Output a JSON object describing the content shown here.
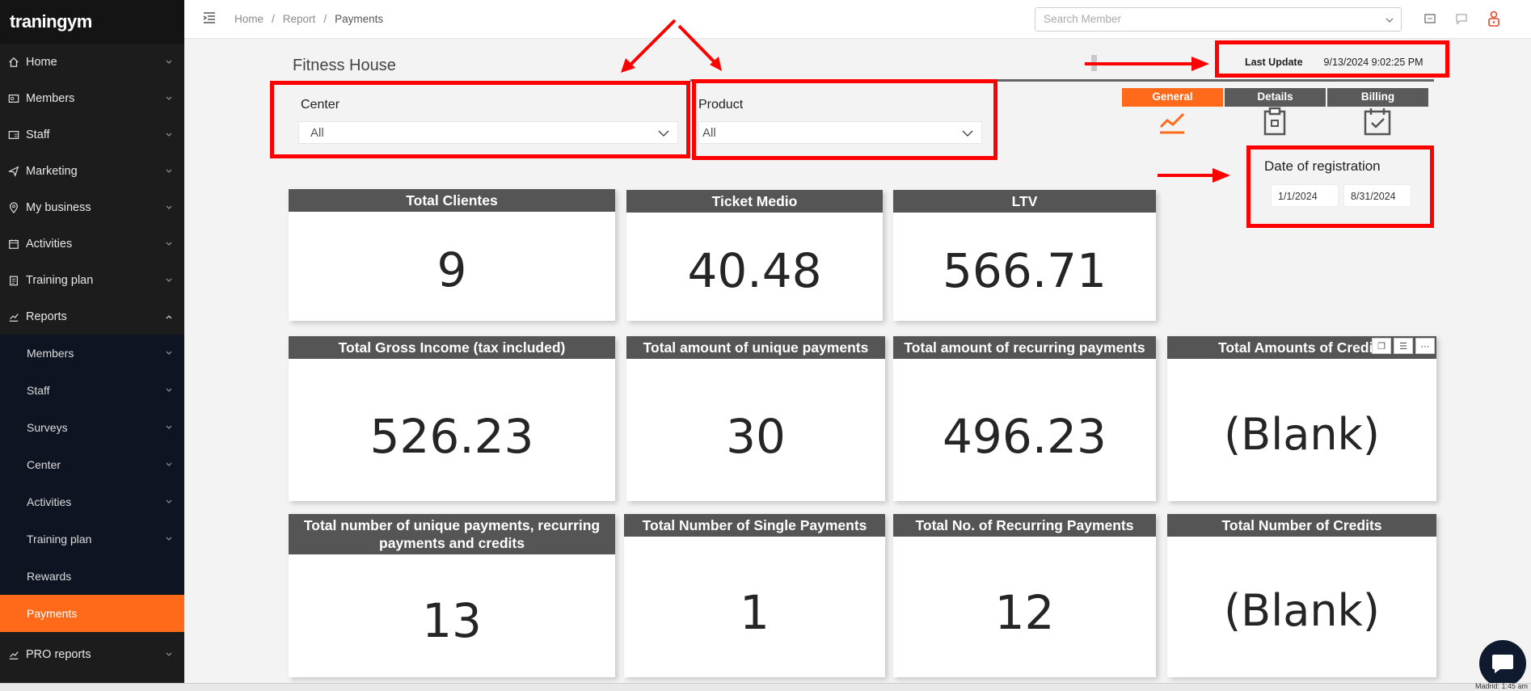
{
  "brand": "traningym",
  "sidebar": {
    "items": [
      {
        "label": "Home",
        "icon": "home-icon"
      },
      {
        "label": "Members",
        "icon": "id-card-icon"
      },
      {
        "label": "Staff",
        "icon": "id-badge-icon"
      },
      {
        "label": "Marketing",
        "icon": "send-icon"
      },
      {
        "label": "My business",
        "icon": "location-pin-icon"
      },
      {
        "label": "Activities",
        "icon": "calendar-icon"
      },
      {
        "label": "Training plan",
        "icon": "clipboard-icon"
      },
      {
        "label": "Reports",
        "icon": "chart-line-icon"
      }
    ],
    "reports_sub": [
      {
        "label": "Members"
      },
      {
        "label": "Staff"
      },
      {
        "label": "Surveys"
      },
      {
        "label": "Center"
      },
      {
        "label": "Activities"
      },
      {
        "label": "Training plan"
      },
      {
        "label": "Rewards"
      },
      {
        "label": "Payments"
      }
    ],
    "pro": {
      "label": "PRO reports",
      "icon": "chart-line-icon"
    }
  },
  "topbar": {
    "breadcrumb": [
      "Home",
      "Report",
      "Payments"
    ],
    "search_placeholder": "Search Member"
  },
  "report": {
    "title": "Fitness House",
    "center_label": "Center",
    "center_value": "All",
    "product_label": "Product",
    "product_value": "All",
    "last_update_label": "Last Update",
    "last_update_value": "9/13/2024 9:02:25 PM",
    "tabs": [
      "General",
      "Details",
      "Billing"
    ],
    "date_label": "Date of registration",
    "date_from": "1/1/2024",
    "date_to": "8/31/2024"
  },
  "cards": [
    {
      "title": "Total Clientes",
      "value": "9"
    },
    {
      "title": "Ticket Medio",
      "value": "40.48"
    },
    {
      "title": "LTV",
      "value": "566.71"
    },
    {
      "title": "Total Gross Income (tax included)",
      "value": "526.23"
    },
    {
      "title": "Total amount of unique payments",
      "value": "30"
    },
    {
      "title": "Total amount of recurring payments",
      "value": "496.23"
    },
    {
      "title": "Total Amounts of Credits",
      "value": "(Blank)"
    },
    {
      "title": "Total number of unique payments, recurring payments and credits",
      "value": "13"
    },
    {
      "title": "Total Number of Single Payments",
      "value": "1"
    },
    {
      "title": "Total No. of Recurring Payments",
      "value": "12"
    },
    {
      "title": "Total Number of Credits",
      "value": "(Blank)"
    }
  ],
  "status": "Madrid: 1:45 am",
  "colors": {
    "accent": "#ff6a1a",
    "sidebar": "#1c1c1c",
    "annotation": "#ff0000",
    "card_header": "#555555"
  }
}
